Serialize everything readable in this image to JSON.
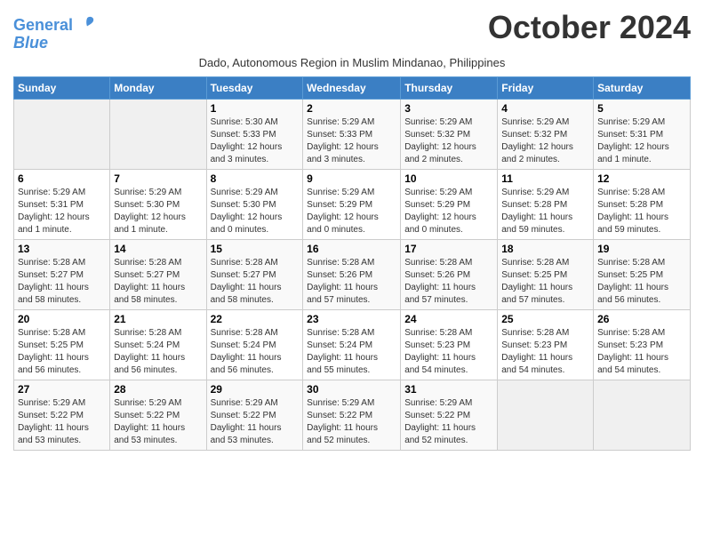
{
  "logo": {
    "line1": "General",
    "line2": "Blue"
  },
  "title": "October 2024",
  "subtitle": "Dado, Autonomous Region in Muslim Mindanao, Philippines",
  "headers": [
    "Sunday",
    "Monday",
    "Tuesday",
    "Wednesday",
    "Thursday",
    "Friday",
    "Saturday"
  ],
  "weeks": [
    [
      {
        "day": "",
        "info": ""
      },
      {
        "day": "",
        "info": ""
      },
      {
        "day": "1",
        "info": "Sunrise: 5:30 AM\nSunset: 5:33 PM\nDaylight: 12 hours\nand 3 minutes."
      },
      {
        "day": "2",
        "info": "Sunrise: 5:29 AM\nSunset: 5:33 PM\nDaylight: 12 hours\nand 3 minutes."
      },
      {
        "day": "3",
        "info": "Sunrise: 5:29 AM\nSunset: 5:32 PM\nDaylight: 12 hours\nand 2 minutes."
      },
      {
        "day": "4",
        "info": "Sunrise: 5:29 AM\nSunset: 5:32 PM\nDaylight: 12 hours\nand 2 minutes."
      },
      {
        "day": "5",
        "info": "Sunrise: 5:29 AM\nSunset: 5:31 PM\nDaylight: 12 hours\nand 1 minute."
      }
    ],
    [
      {
        "day": "6",
        "info": "Sunrise: 5:29 AM\nSunset: 5:31 PM\nDaylight: 12 hours\nand 1 minute."
      },
      {
        "day": "7",
        "info": "Sunrise: 5:29 AM\nSunset: 5:30 PM\nDaylight: 12 hours\nand 1 minute."
      },
      {
        "day": "8",
        "info": "Sunrise: 5:29 AM\nSunset: 5:30 PM\nDaylight: 12 hours\nand 0 minutes."
      },
      {
        "day": "9",
        "info": "Sunrise: 5:29 AM\nSunset: 5:29 PM\nDaylight: 12 hours\nand 0 minutes."
      },
      {
        "day": "10",
        "info": "Sunrise: 5:29 AM\nSunset: 5:29 PM\nDaylight: 12 hours\nand 0 minutes."
      },
      {
        "day": "11",
        "info": "Sunrise: 5:29 AM\nSunset: 5:28 PM\nDaylight: 11 hours\nand 59 minutes."
      },
      {
        "day": "12",
        "info": "Sunrise: 5:28 AM\nSunset: 5:28 PM\nDaylight: 11 hours\nand 59 minutes."
      }
    ],
    [
      {
        "day": "13",
        "info": "Sunrise: 5:28 AM\nSunset: 5:27 PM\nDaylight: 11 hours\nand 58 minutes."
      },
      {
        "day": "14",
        "info": "Sunrise: 5:28 AM\nSunset: 5:27 PM\nDaylight: 11 hours\nand 58 minutes."
      },
      {
        "day": "15",
        "info": "Sunrise: 5:28 AM\nSunset: 5:27 PM\nDaylight: 11 hours\nand 58 minutes."
      },
      {
        "day": "16",
        "info": "Sunrise: 5:28 AM\nSunset: 5:26 PM\nDaylight: 11 hours\nand 57 minutes."
      },
      {
        "day": "17",
        "info": "Sunrise: 5:28 AM\nSunset: 5:26 PM\nDaylight: 11 hours\nand 57 minutes."
      },
      {
        "day": "18",
        "info": "Sunrise: 5:28 AM\nSunset: 5:25 PM\nDaylight: 11 hours\nand 57 minutes."
      },
      {
        "day": "19",
        "info": "Sunrise: 5:28 AM\nSunset: 5:25 PM\nDaylight: 11 hours\nand 56 minutes."
      }
    ],
    [
      {
        "day": "20",
        "info": "Sunrise: 5:28 AM\nSunset: 5:25 PM\nDaylight: 11 hours\nand 56 minutes."
      },
      {
        "day": "21",
        "info": "Sunrise: 5:28 AM\nSunset: 5:24 PM\nDaylight: 11 hours\nand 56 minutes."
      },
      {
        "day": "22",
        "info": "Sunrise: 5:28 AM\nSunset: 5:24 PM\nDaylight: 11 hours\nand 56 minutes."
      },
      {
        "day": "23",
        "info": "Sunrise: 5:28 AM\nSunset: 5:24 PM\nDaylight: 11 hours\nand 55 minutes."
      },
      {
        "day": "24",
        "info": "Sunrise: 5:28 AM\nSunset: 5:23 PM\nDaylight: 11 hours\nand 54 minutes."
      },
      {
        "day": "25",
        "info": "Sunrise: 5:28 AM\nSunset: 5:23 PM\nDaylight: 11 hours\nand 54 minutes."
      },
      {
        "day": "26",
        "info": "Sunrise: 5:28 AM\nSunset: 5:23 PM\nDaylight: 11 hours\nand 54 minutes."
      }
    ],
    [
      {
        "day": "27",
        "info": "Sunrise: 5:29 AM\nSunset: 5:22 PM\nDaylight: 11 hours\nand 53 minutes."
      },
      {
        "day": "28",
        "info": "Sunrise: 5:29 AM\nSunset: 5:22 PM\nDaylight: 11 hours\nand 53 minutes."
      },
      {
        "day": "29",
        "info": "Sunrise: 5:29 AM\nSunset: 5:22 PM\nDaylight: 11 hours\nand 53 minutes."
      },
      {
        "day": "30",
        "info": "Sunrise: 5:29 AM\nSunset: 5:22 PM\nDaylight: 11 hours\nand 52 minutes."
      },
      {
        "day": "31",
        "info": "Sunrise: 5:29 AM\nSunset: 5:22 PM\nDaylight: 11 hours\nand 52 minutes."
      },
      {
        "day": "",
        "info": ""
      },
      {
        "day": "",
        "info": ""
      }
    ]
  ]
}
